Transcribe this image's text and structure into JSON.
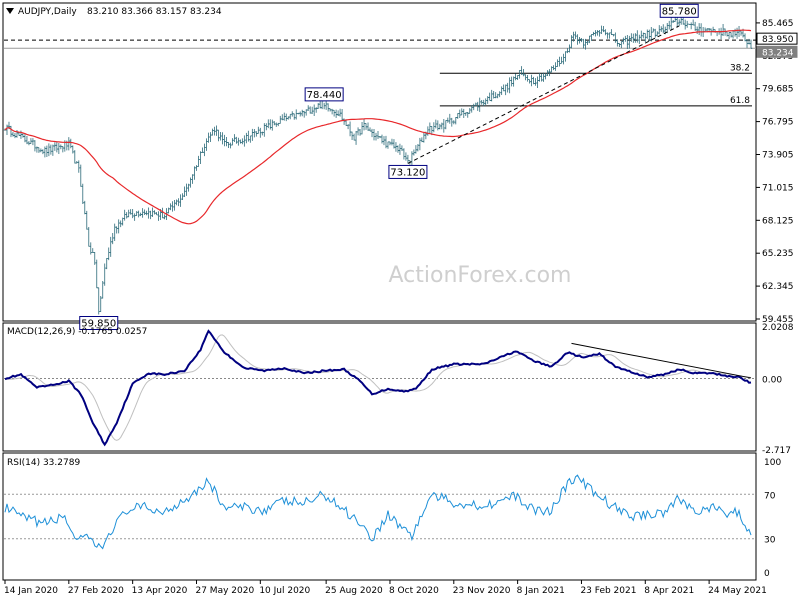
{
  "chart_data": [
    {
      "type": "ohlc",
      "panel": "price",
      "title": "AUDJPY,Daily",
      "ohlc_readout": "83.210 83.366 83.157 83.234",
      "watermark": "ActionForex.com",
      "ylim": [
        59.455,
        86.95
      ],
      "y_ticks": [
        85.465,
        82.575,
        79.685,
        76.795,
        73.905,
        71.015,
        68.125,
        65.235,
        62.345,
        59.455
      ],
      "x_labels": [
        "14 Jan 2020",
        "27 Feb 2020",
        "13 Apr 2020",
        "27 May 2020",
        "10 Jul 2020",
        "25 Aug 2020",
        "8 Oct 2020",
        "23 Nov 2020",
        "8 Jan 2021",
        "23 Feb 2021",
        "8 Apr 2021",
        "24 May 2021"
      ],
      "bar_count": 375,
      "anchors": [
        {
          "i": 0,
          "v": 76.3
        },
        {
          "i": 10,
          "v": 75.2
        },
        {
          "i": 20,
          "v": 74.2
        },
        {
          "i": 32,
          "v": 74.8
        },
        {
          "i": 37,
          "v": 72.5
        },
        {
          "i": 42,
          "v": 66.0
        },
        {
          "i": 45,
          "v": 64.5
        },
        {
          "i": 47,
          "v": 59.85
        },
        {
          "i": 50,
          "v": 64.0
        },
        {
          "i": 55,
          "v": 67.5
        },
        {
          "i": 62,
          "v": 68.7
        },
        {
          "i": 70,
          "v": 68.9
        },
        {
          "i": 80,
          "v": 68.5
        },
        {
          "i": 90,
          "v": 70.5
        },
        {
          "i": 100,
          "v": 74.8
        },
        {
          "i": 105,
          "v": 76.2
        },
        {
          "i": 110,
          "v": 74.8
        },
        {
          "i": 120,
          "v": 75.3
        },
        {
          "i": 130,
          "v": 76.2
        },
        {
          "i": 140,
          "v": 77.0
        },
        {
          "i": 150,
          "v": 77.6
        },
        {
          "i": 160,
          "v": 78.44
        },
        {
          "i": 168,
          "v": 77.4
        },
        {
          "i": 175,
          "v": 75.4
        },
        {
          "i": 180,
          "v": 76.4
        },
        {
          "i": 186,
          "v": 75.5
        },
        {
          "i": 192,
          "v": 74.8
        },
        {
          "i": 198,
          "v": 74.4
        },
        {
          "i": 202,
          "v": 73.12
        },
        {
          "i": 207,
          "v": 74.6
        },
        {
          "i": 212,
          "v": 76.2
        },
        {
          "i": 220,
          "v": 76.5
        },
        {
          "i": 230,
          "v": 77.6
        },
        {
          "i": 240,
          "v": 78.6
        },
        {
          "i": 250,
          "v": 79.6
        },
        {
          "i": 258,
          "v": 81.0
        },
        {
          "i": 265,
          "v": 80.4
        },
        {
          "i": 272,
          "v": 81.0
        },
        {
          "i": 280,
          "v": 82.4
        },
        {
          "i": 285,
          "v": 84.4
        },
        {
          "i": 290,
          "v": 83.8
        },
        {
          "i": 300,
          "v": 85.0
        },
        {
          "i": 308,
          "v": 83.6
        },
        {
          "i": 318,
          "v": 84.3
        },
        {
          "i": 330,
          "v": 84.8
        },
        {
          "i": 338,
          "v": 85.78
        },
        {
          "i": 345,
          "v": 85.0
        },
        {
          "i": 355,
          "v": 84.8
        },
        {
          "i": 362,
          "v": 84.6
        },
        {
          "i": 368,
          "v": 84.5
        },
        {
          "i": 372,
          "v": 83.9
        },
        {
          "i": 374,
          "v": 83.234
        }
      ],
      "moving_average": {
        "period": 55,
        "color": "#e8282b"
      },
      "price_labels": [
        {
          "text": "85.780",
          "i": 338,
          "v": 85.78,
          "pos": "above"
        },
        {
          "text": "78.440",
          "i": 160,
          "v": 78.44,
          "pos": "above"
        },
        {
          "text": "73.120",
          "i": 202,
          "v": 73.12,
          "pos": "below"
        },
        {
          "text": "59.850",
          "i": 47,
          "v": 59.85,
          "pos": "below"
        }
      ],
      "right_axis_badges": [
        {
          "text": "83.950",
          "v": 83.95
        },
        {
          "text": "83.234",
          "v": 83.234
        }
      ],
      "fib_lines": [
        {
          "label": "38.2",
          "v": 81.04,
          "i_start": 218
        },
        {
          "label": "61.8",
          "v": 78.18,
          "i_start": 218
        }
      ],
      "dashed_trendline": [
        {
          "i": 202,
          "v": 73.12
        },
        {
          "i": 338,
          "v": 85.2
        }
      ],
      "horizontal_lines": [
        {
          "v": 83.95,
          "dashed": true
        },
        {
          "v": 83.234,
          "dashed": false
        }
      ],
      "colors": {
        "bars": "#2d6b7a",
        "ma": "#e8282b",
        "text": "#000000",
        "trend": "#000000"
      }
    },
    {
      "type": "line",
      "panel": "macd",
      "title": "MACD(12,26,9) -0.1765 0.0257",
      "ylim": [
        -2.717,
        2.0208
      ],
      "y_ticks": [
        2.0208,
        0.0,
        -2.717
      ],
      "macd_anchors": [
        {
          "i": 0,
          "v": 0.0
        },
        {
          "i": 8,
          "v": 0.15
        },
        {
          "i": 16,
          "v": -0.35
        },
        {
          "i": 24,
          "v": -0.25
        },
        {
          "i": 32,
          "v": -0.1
        },
        {
          "i": 38,
          "v": -0.6
        },
        {
          "i": 44,
          "v": -1.7
        },
        {
          "i": 50,
          "v": -2.55
        },
        {
          "i": 56,
          "v": -1.7
        },
        {
          "i": 64,
          "v": -0.2
        },
        {
          "i": 72,
          "v": 0.2
        },
        {
          "i": 80,
          "v": 0.15
        },
        {
          "i": 90,
          "v": 0.3
        },
        {
          "i": 98,
          "v": 1.1
        },
        {
          "i": 102,
          "v": 1.85
        },
        {
          "i": 110,
          "v": 1.0
        },
        {
          "i": 120,
          "v": 0.4
        },
        {
          "i": 130,
          "v": 0.3
        },
        {
          "i": 140,
          "v": 0.4
        },
        {
          "i": 150,
          "v": 0.2
        },
        {
          "i": 160,
          "v": 0.3
        },
        {
          "i": 170,
          "v": 0.35
        },
        {
          "i": 178,
          "v": -0.1
        },
        {
          "i": 184,
          "v": -0.6
        },
        {
          "i": 192,
          "v": -0.4
        },
        {
          "i": 200,
          "v": -0.5
        },
        {
          "i": 206,
          "v": -0.4
        },
        {
          "i": 214,
          "v": 0.35
        },
        {
          "i": 225,
          "v": 0.55
        },
        {
          "i": 240,
          "v": 0.55
        },
        {
          "i": 256,
          "v": 1.05
        },
        {
          "i": 266,
          "v": 0.65
        },
        {
          "i": 274,
          "v": 0.45
        },
        {
          "i": 282,
          "v": 1.0
        },
        {
          "i": 290,
          "v": 0.8
        },
        {
          "i": 298,
          "v": 0.95
        },
        {
          "i": 306,
          "v": 0.45
        },
        {
          "i": 314,
          "v": 0.25
        },
        {
          "i": 322,
          "v": 0.05
        },
        {
          "i": 330,
          "v": 0.15
        },
        {
          "i": 338,
          "v": 0.35
        },
        {
          "i": 346,
          "v": 0.2
        },
        {
          "i": 354,
          "v": 0.2
        },
        {
          "i": 362,
          "v": 0.1
        },
        {
          "i": 368,
          "v": 0.05
        },
        {
          "i": 374,
          "v": -0.18
        }
      ],
      "signal_lag": 4,
      "signal_smoothing": 4,
      "zero_line": true,
      "trendline": [
        {
          "i": 284,
          "v": 1.35
        },
        {
          "i": 374,
          "v": 0.02
        }
      ],
      "colors": {
        "macd": "#000080",
        "signal": "#c0c0c0",
        "zero": "#888888",
        "trend": "#000000"
      }
    },
    {
      "type": "line",
      "panel": "rsi",
      "title": "RSI(14) 33.2789",
      "ylim": [
        0,
        100
      ],
      "y_ticks": [
        100,
        70,
        30,
        0
      ],
      "levels": [
        70,
        30
      ],
      "anchors": [
        {
          "i": 0,
          "v": 58
        },
        {
          "i": 10,
          "v": 48
        },
        {
          "i": 20,
          "v": 44
        },
        {
          "i": 30,
          "v": 50
        },
        {
          "i": 36,
          "v": 28
        },
        {
          "i": 42,
          "v": 30
        },
        {
          "i": 48,
          "v": 20
        },
        {
          "i": 54,
          "v": 40
        },
        {
          "i": 62,
          "v": 57
        },
        {
          "i": 70,
          "v": 58
        },
        {
          "i": 80,
          "v": 54
        },
        {
          "i": 92,
          "v": 68
        },
        {
          "i": 102,
          "v": 82
        },
        {
          "i": 110,
          "v": 58
        },
        {
          "i": 120,
          "v": 58
        },
        {
          "i": 130,
          "v": 56
        },
        {
          "i": 140,
          "v": 64
        },
        {
          "i": 150,
          "v": 62
        },
        {
          "i": 160,
          "v": 70
        },
        {
          "i": 170,
          "v": 56
        },
        {
          "i": 178,
          "v": 45
        },
        {
          "i": 184,
          "v": 30
        },
        {
          "i": 192,
          "v": 52
        },
        {
          "i": 198,
          "v": 42
        },
        {
          "i": 204,
          "v": 33
        },
        {
          "i": 214,
          "v": 70
        },
        {
          "i": 225,
          "v": 62
        },
        {
          "i": 240,
          "v": 60
        },
        {
          "i": 256,
          "v": 68
        },
        {
          "i": 266,
          "v": 55
        },
        {
          "i": 274,
          "v": 56
        },
        {
          "i": 282,
          "v": 80
        },
        {
          "i": 288,
          "v": 84
        },
        {
          "i": 296,
          "v": 70
        },
        {
          "i": 306,
          "v": 58
        },
        {
          "i": 314,
          "v": 50
        },
        {
          "i": 322,
          "v": 52
        },
        {
          "i": 330,
          "v": 54
        },
        {
          "i": 338,
          "v": 66
        },
        {
          "i": 346,
          "v": 55
        },
        {
          "i": 354,
          "v": 58
        },
        {
          "i": 362,
          "v": 52
        },
        {
          "i": 368,
          "v": 54
        },
        {
          "i": 374,
          "v": 33.28
        }
      ],
      "colors": {
        "rsi": "#1e90d8",
        "levels": "#999999"
      }
    }
  ]
}
